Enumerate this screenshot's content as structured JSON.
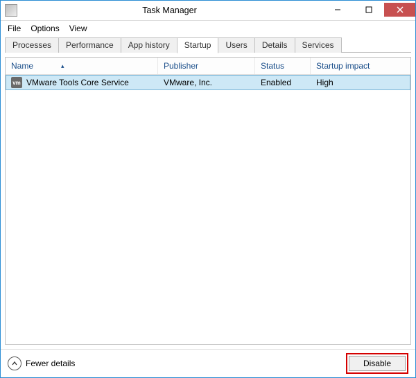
{
  "window": {
    "title": "Task Manager"
  },
  "menu": {
    "file": "File",
    "options": "Options",
    "view": "View"
  },
  "tabs": {
    "processes": "Processes",
    "performance": "Performance",
    "app_history": "App history",
    "startup": "Startup",
    "users": "Users",
    "details": "Details",
    "services": "Services"
  },
  "columns": {
    "name": "Name",
    "publisher": "Publisher",
    "status": "Status",
    "impact": "Startup impact"
  },
  "rows": [
    {
      "icon_text": "vm",
      "name": "VMware Tools Core Service",
      "publisher": "VMware, Inc.",
      "status": "Enabled",
      "impact": "High",
      "selected": true
    }
  ],
  "footer": {
    "fewer": "Fewer details",
    "disable": "Disable"
  }
}
